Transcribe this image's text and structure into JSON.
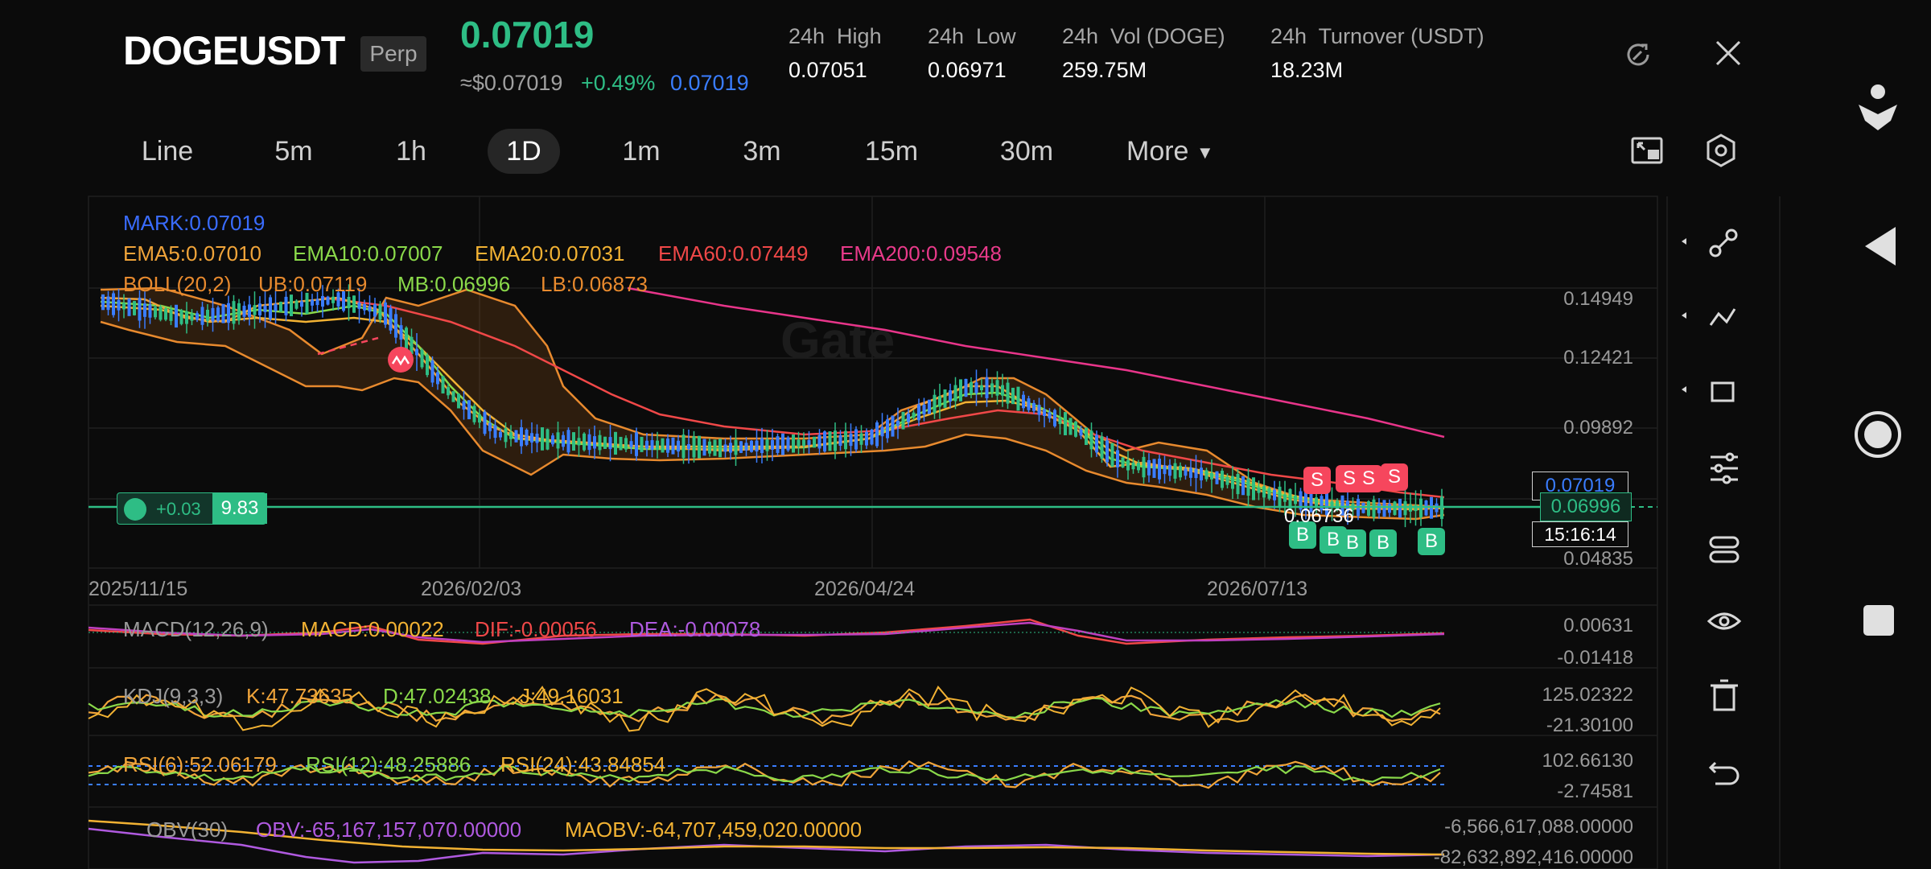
{
  "header": {
    "symbol": "DOGEUSDT",
    "contract_type": "Perp",
    "last_price": "0.07019",
    "usd_price": "≈$0.07019",
    "change_pct": "+0.49%",
    "mark_price": "0.07019",
    "stats": [
      {
        "label": "24h  High",
        "value": "0.07051"
      },
      {
        "label": "24h  Low",
        "value": "0.06971"
      },
      {
        "label": "24h  Vol (DOGE)",
        "value": "259.75M"
      },
      {
        "label": "24h  Turnover (USDT)",
        "value": "18.23M"
      }
    ]
  },
  "timeframes": [
    "Line",
    "5m",
    "1h",
    "1D",
    "1m",
    "3m",
    "15m",
    "30m",
    "More"
  ],
  "active_timeframe": "1D",
  "main_chart": {
    "mark": "MARK:0.07019",
    "ema": [
      {
        "text": "EMA5:0.07010",
        "color": "#f0a43a"
      },
      {
        "text": "EMA10:0.07007",
        "color": "#8ad94a"
      },
      {
        "text": "EMA20:0.07031",
        "color": "#f2b233"
      },
      {
        "text": "EMA60:0.07449",
        "color": "#f04848"
      },
      {
        "text": "EMA200:0.09548",
        "color": "#e83a8a"
      }
    ],
    "boll": [
      {
        "text": "BOLL(20,2)",
        "color": "#e88a2e"
      },
      {
        "text": "UB:0.07119",
        "color": "#e88a2e"
      },
      {
        "text": "MB:0.06996",
        "color": "#8ad94a"
      },
      {
        "text": "LB:0.06873",
        "color": "#e88a2e"
      }
    ],
    "price_axis": [
      "0.14949",
      "0.12421",
      "0.09892",
      "0.04835"
    ],
    "dates": [
      "2025/11/15",
      "2026/02/03",
      "2026/04/24",
      "2026/07/13"
    ],
    "position_pnl": "+0.03",
    "position_size": "9.83",
    "low_marker": "0.06736",
    "price_tag_mark": "0.07019",
    "price_tag_last": "0.06996",
    "countdown": "15:16:14",
    "sell_markers": [
      "S",
      "S",
      "S",
      "S"
    ],
    "buy_markers": [
      "B",
      "B",
      "B",
      "B",
      "B"
    ],
    "watermark": "Gate"
  },
  "macd": {
    "labels": [
      {
        "text": "MACD(12,26,9)",
        "color": "#9a9a9a"
      },
      {
        "text": "MACD:0.00022",
        "color": "#f2b233"
      },
      {
        "text": "DIF:-0.00056",
        "color": "#f04848"
      },
      {
        "text": "DEA:-0.00078",
        "color": "#b05ae0"
      }
    ],
    "axis": [
      "0.00631",
      "-0.01418"
    ]
  },
  "kdj": {
    "labels": [
      {
        "text": "KDJ(9,3,3)",
        "color": "#9a9a9a"
      },
      {
        "text": "K:47.73635",
        "color": "#f0a43a"
      },
      {
        "text": "D:47.02438",
        "color": "#8ad94a"
      },
      {
        "text": "J:49.16031",
        "color": "#f2b233"
      }
    ],
    "axis": [
      "125.02322",
      "-21.30100"
    ]
  },
  "rsi": {
    "labels": [
      {
        "text": "RSI(6):52.06179",
        "color": "#f0a43a"
      },
      {
        "text": "RSI(12):48.25886",
        "color": "#8ad94a"
      },
      {
        "text": "RSI(24):43.84854",
        "color": "#f2b233"
      }
    ],
    "axis": [
      "102.66130",
      "-2.74581"
    ]
  },
  "obv": {
    "labels": [
      {
        "text": "OBV(30)",
        "color": "#9a9a9a"
      },
      {
        "text": "OBV:-65,167,157,070.00000",
        "color": "#b05ae0"
      },
      {
        "text": "MAOBV:-64,707,459,020.00000",
        "color": "#f2b233"
      }
    ],
    "axis": [
      "-6,566,617,088.00000",
      "-82,632,892,416.00000"
    ]
  },
  "tools": [
    "line-tool",
    "fibonacci-tool",
    "shape-tool",
    "indicator-settings",
    "drawing-settings",
    "visibility",
    "delete",
    "undo"
  ],
  "system_nav": [
    "accessibility",
    "back",
    "home",
    "recents"
  ],
  "colors": {
    "up": "#2ebd85",
    "down": "#f6465d",
    "accent": "#3a7dff",
    "bg": "#0b0b0b"
  }
}
